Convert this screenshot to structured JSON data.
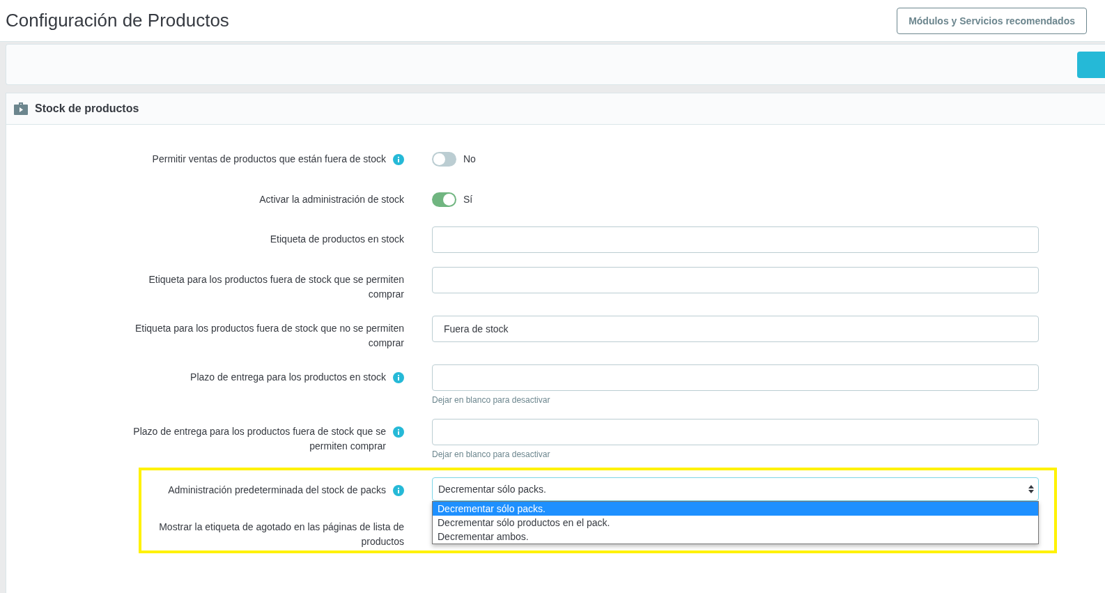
{
  "page": {
    "title": "Configuración de Productos",
    "header_button": "Módulos y Servicios recomendados"
  },
  "panel": {
    "title": "Stock de productos",
    "fields": [
      {
        "kind": "toggle",
        "label": "Permitir ventas de productos que están fuera de stock",
        "info": true,
        "on": false,
        "state_label": "No"
      },
      {
        "kind": "toggle",
        "label": "Activar la administración de stock",
        "info": false,
        "on": true,
        "state_label": "Sí"
      },
      {
        "kind": "text",
        "label": "Etiqueta de productos en stock",
        "info": false
      },
      {
        "kind": "text",
        "label": "Etiqueta para los productos fuera de stock que se permiten comprar",
        "info": false
      },
      {
        "kind": "text",
        "label": "Etiqueta para los productos fuera de stock que no se permiten comprar",
        "info": false,
        "value": "Fuera de stock"
      },
      {
        "kind": "text",
        "label": "Plazo de entrega para los productos en stock",
        "info": true,
        "help": "Dejar en blanco para desactivar"
      },
      {
        "kind": "text",
        "label": "Plazo de entrega para los productos fuera de stock que se permiten comprar",
        "info": true,
        "help": "Dejar en blanco para desactivar"
      }
    ],
    "highlighted_fields": [
      {
        "kind": "select",
        "label": "Administración predeterminada del stock de packs",
        "info": true,
        "value": "Decrementar sólo packs.",
        "expanded": true,
        "options": [
          {
            "label": "Decrementar sólo packs.",
            "selected": true
          },
          {
            "label": "Decrementar sólo productos en el pack.",
            "selected": false
          },
          {
            "label": "Decrementar ambos.",
            "selected": false
          }
        ]
      },
      {
        "kind": "note",
        "label": "Mostrar la etiqueta de agotado en las páginas de lista de productos",
        "info": false
      }
    ]
  }
}
